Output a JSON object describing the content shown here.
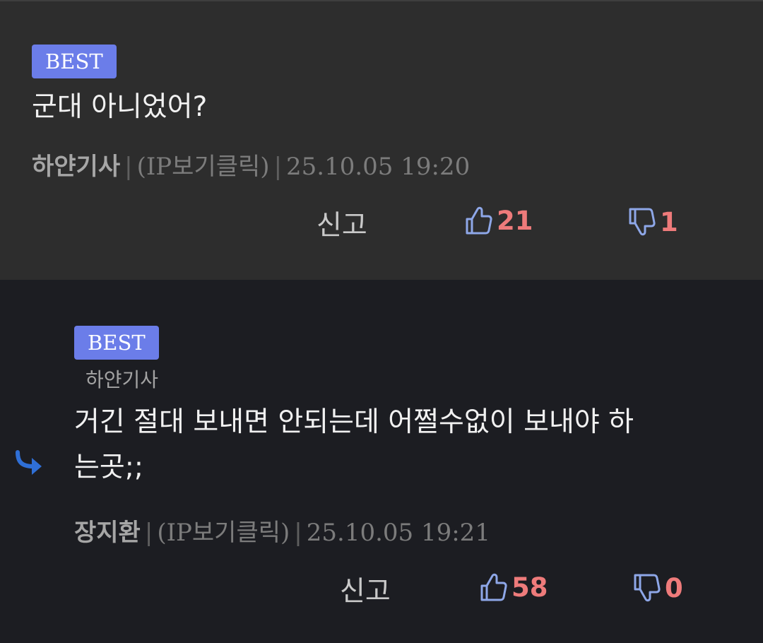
{
  "comments": [
    {
      "badge": "BEST",
      "text": "군대 아니었어?",
      "author": "하얀기사",
      "ip": "(IP보기클릭)",
      "date": "25.10.05 19:20",
      "report_label": "신고",
      "upvotes": "21",
      "downvotes": "1"
    },
    {
      "badge": "BEST",
      "reply_to": "하얀기사",
      "text_line1": "거긴 절대 보내면 안되는데 어쩔수없이 보내야 하",
      "text_line2": "는곳;;",
      "author": "장지환",
      "ip": "(IP보기클릭)",
      "date": "25.10.05 19:21",
      "report_label": "신고",
      "upvotes": "58",
      "downvotes": "0"
    }
  ],
  "meta_separator": "|",
  "colors": {
    "badge_bg": "#6b7de9",
    "vote_count": "#ee7b7b",
    "thumb_icon": "#8ea7e8",
    "reply_arrow": "#2f6fd6",
    "card1_bg": "#2d2d2d",
    "card2_bg": "#1c1d22"
  },
  "icons": {
    "upvote": "thumbs-up-icon",
    "downvote": "thumbs-down-icon",
    "reply": "reply-arrow-icon"
  }
}
